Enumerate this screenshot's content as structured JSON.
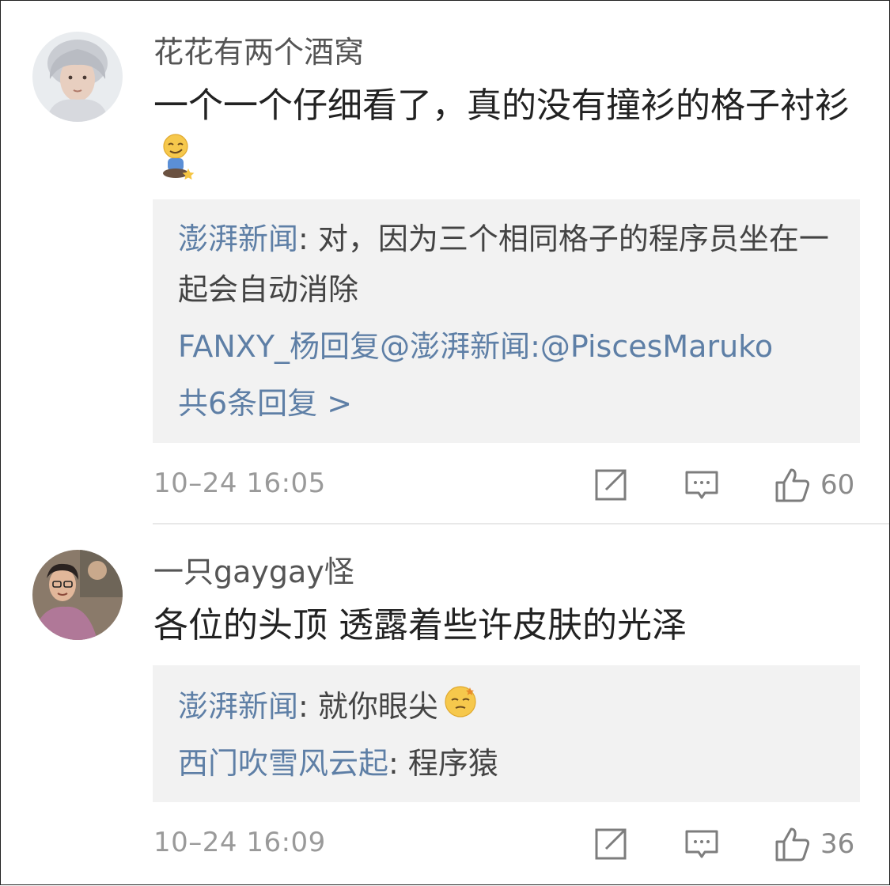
{
  "comments": [
    {
      "username": "花花有两个酒窝",
      "text": "一个一个仔细看了，真的没有撞衫的格子衬衫",
      "emoji": "sitting-smirk-emoji",
      "replies": [
        {
          "author": "澎湃新闻",
          "sep": ": ",
          "text": "对，因为三个相同格子的程序员坐在一起会自动消除"
        },
        {
          "author": "FANXY_杨",
          "mid": "回复",
          "target": "@澎湃新闻",
          "sep": ":",
          "text": "@PiscesMaruko"
        }
      ],
      "more_replies": "共6条回复 >",
      "timestamp": "10–24 16:05",
      "like_count": "60"
    },
    {
      "username": "一只gaygay怪",
      "text": "各位的头顶 透露着些许皮肤的光泽",
      "replies": [
        {
          "author": "澎湃新闻",
          "sep": ": ",
          "text": "就你眼尖",
          "emoji": "dizzy-face-emoji"
        },
        {
          "author": "西门吹雪风云起",
          "sep": ": ",
          "text": "程序猿"
        }
      ],
      "timestamp": "10–24 16:09",
      "like_count": "36"
    }
  ],
  "icons": {
    "share": "share-edit-icon",
    "comment": "comment-bubble-icon",
    "like": "thumbs-up-icon"
  },
  "colors": {
    "link": "#5e7fa6",
    "reply_bg": "#f2f2f2",
    "meta": "#9a9a9a"
  }
}
